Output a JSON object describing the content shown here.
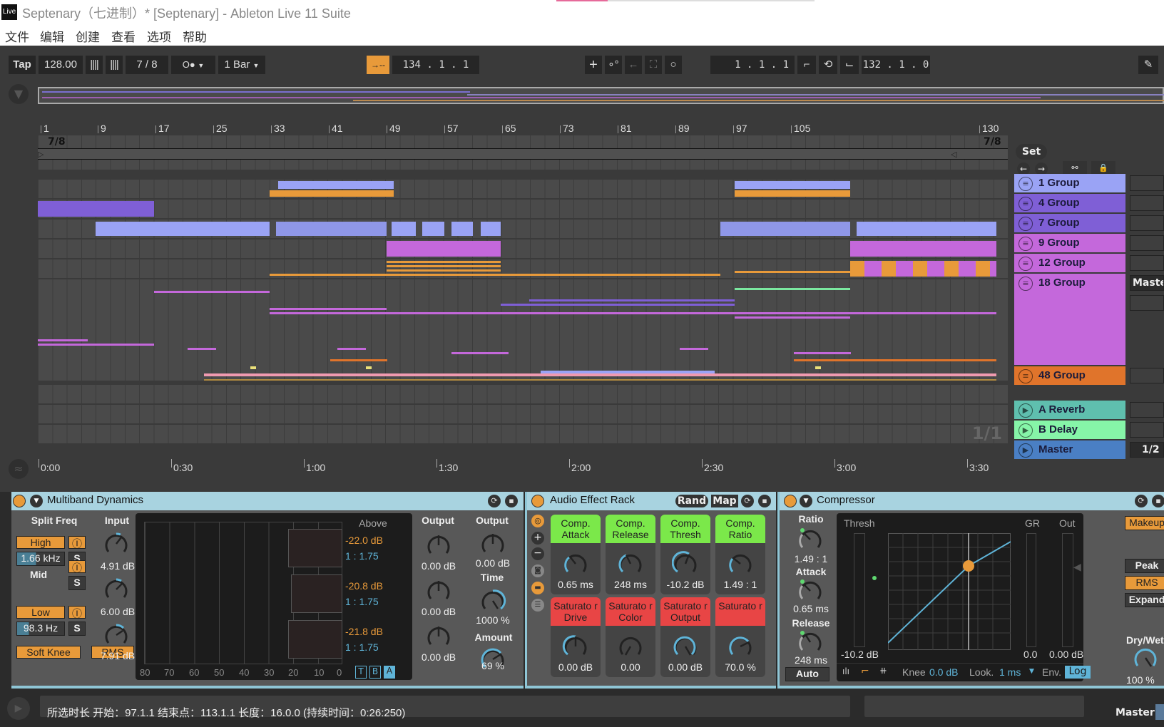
{
  "window": {
    "logo": "Live",
    "title": "Septenary（七进制）*  [Septenary] - Ableton Live 11 Suite"
  },
  "menu": [
    "文件",
    "编辑",
    "创建",
    "查看",
    "选项",
    "帮助"
  ],
  "transport": {
    "tap": "Tap",
    "tempo": "128.00",
    "time_signature": "7 / 8",
    "metronome": "O●",
    "quantize": "1 Bar",
    "follow_icon": "→--",
    "position": "134 .  1 .  1",
    "loop_start": "1 .  1 .  1",
    "loop_length": "132 .  1 .  0",
    "colors": {
      "accent_orange": "#e89a3a"
    }
  },
  "ruler": {
    "bars": [
      "1",
      "9",
      "17",
      "25",
      "33",
      "41",
      "49",
      "57",
      "65",
      "73",
      "81",
      "89",
      "97",
      "105",
      "130"
    ],
    "sig_start": "7/8",
    "sig_end": "7/8",
    "set_label": "Set"
  },
  "time_ruler": [
    "0:00",
    "0:30",
    "1:00",
    "1:30",
    "2:00",
    "2:30",
    "3:00",
    "3:30"
  ],
  "page_indicator": "1/1",
  "tracks": [
    {
      "name": "1 Group",
      "color": "#9aa3f5",
      "icon": "group-icon"
    },
    {
      "name": "4 Group",
      "color": "#7f5fd6",
      "icon": "group-icon"
    },
    {
      "name": "7 Group",
      "color": "#7f5fd6",
      "icon": "group-icon"
    },
    {
      "name": "9 Group",
      "color": "#c468db",
      "icon": "group-icon"
    },
    {
      "name": "12 Group",
      "color": "#c468db",
      "icon": "group-icon"
    },
    {
      "name": "18 Group",
      "color": "#c468db",
      "icon": "group-icon",
      "io": "Maste"
    },
    {
      "name": "48 Group",
      "color": "#e0742b",
      "icon": "group-icon"
    },
    {
      "name": "A Reverb",
      "color": "#5fbfae",
      "icon": "play-icon"
    },
    {
      "name": "B Delay",
      "color": "#86f5a8",
      "icon": "play-icon"
    },
    {
      "name": "Master",
      "color": "#4a7fc4",
      "icon": "play-icon",
      "io": "1/2"
    }
  ],
  "multiband": {
    "title": "Multiband Dynamics",
    "split_freq": "Split Freq",
    "input": "Input",
    "high": "High",
    "high_freq": "1.66 kHz",
    "mid": "Mid",
    "low": "Low",
    "low_freq": "98.3 Hz",
    "solo": "S",
    "input_vals": [
      "4.91 dB",
      "6.00 dB",
      "7.91 dB"
    ],
    "soft_knee": "Soft Knee",
    "rms": "RMS",
    "above": "Above",
    "thresholds": [
      "-22.0 dB",
      "-20.8 dB",
      "-21.8 dB"
    ],
    "ratios": [
      "1 : 1.75",
      "1 : 1.75",
      "1 : 1.75"
    ],
    "scale": [
      "80",
      "70",
      "60",
      "50",
      "40",
      "30",
      "20",
      "10",
      "0"
    ],
    "tba": [
      "T",
      "B",
      "A"
    ],
    "output": "Output",
    "output_vals": [
      "0.00 dB",
      "0.00 dB",
      "0.00 dB"
    ],
    "master_output": "Output",
    "master_output_val": "0.00 dB",
    "time": "Time",
    "time_val": "1000 %",
    "amount": "Amount",
    "amount_val": "69 %"
  },
  "rack": {
    "title": "Audio Effect Rack",
    "rand": "Rand",
    "map": "Map",
    "macros": [
      {
        "label": "Comp. Attack",
        "value": "0.65 ms",
        "color": "#7be84a"
      },
      {
        "label": "Comp. Release",
        "value": "248 ms",
        "color": "#7be84a"
      },
      {
        "label": "Comp. Thresh",
        "value": "-10.2 dB",
        "color": "#7be84a"
      },
      {
        "label": "Comp. Ratio",
        "value": "1.49 : 1",
        "color": "#7be84a"
      },
      {
        "label": "Saturato r Drive",
        "value": "0.00 dB",
        "color": "#e84545"
      },
      {
        "label": "Saturato r Color",
        "value": "0.00",
        "color": "#e84545"
      },
      {
        "label": "Saturato r Output",
        "value": "0.00 dB",
        "color": "#e84545"
      },
      {
        "label": "Saturato r",
        "value": "70.0 %",
        "color": "#e84545"
      }
    ]
  },
  "compressor": {
    "title": "Compressor",
    "ratio": "Ratio",
    "ratio_val": "1.49 : 1",
    "attack": "Attack",
    "attack_val": "0.65 ms",
    "release": "Release",
    "release_val": "248 ms",
    "auto": "Auto",
    "thresh": "Thresh",
    "thresh_val": "-10.2 dB",
    "gr": "GR",
    "gr_val": "0.0",
    "out": "Out",
    "out_val": "0.00 dB",
    "knee_label": "Knee",
    "knee_val": "0.0 dB",
    "look_label": "Look.",
    "look_val": "1 ms",
    "env_label": "Env.",
    "env_val": "Log",
    "makeup": "Makeup",
    "peak": "Peak",
    "rms": "RMS",
    "expand": "Expand",
    "drywet": "Dry/Wet",
    "drywet_val": "100 %"
  },
  "status": {
    "text": "所选时长    开始：97.1.1    结束点：113.1.1    长度：16.0.0 (持续时间：0:26:250)",
    "master": "Master"
  }
}
